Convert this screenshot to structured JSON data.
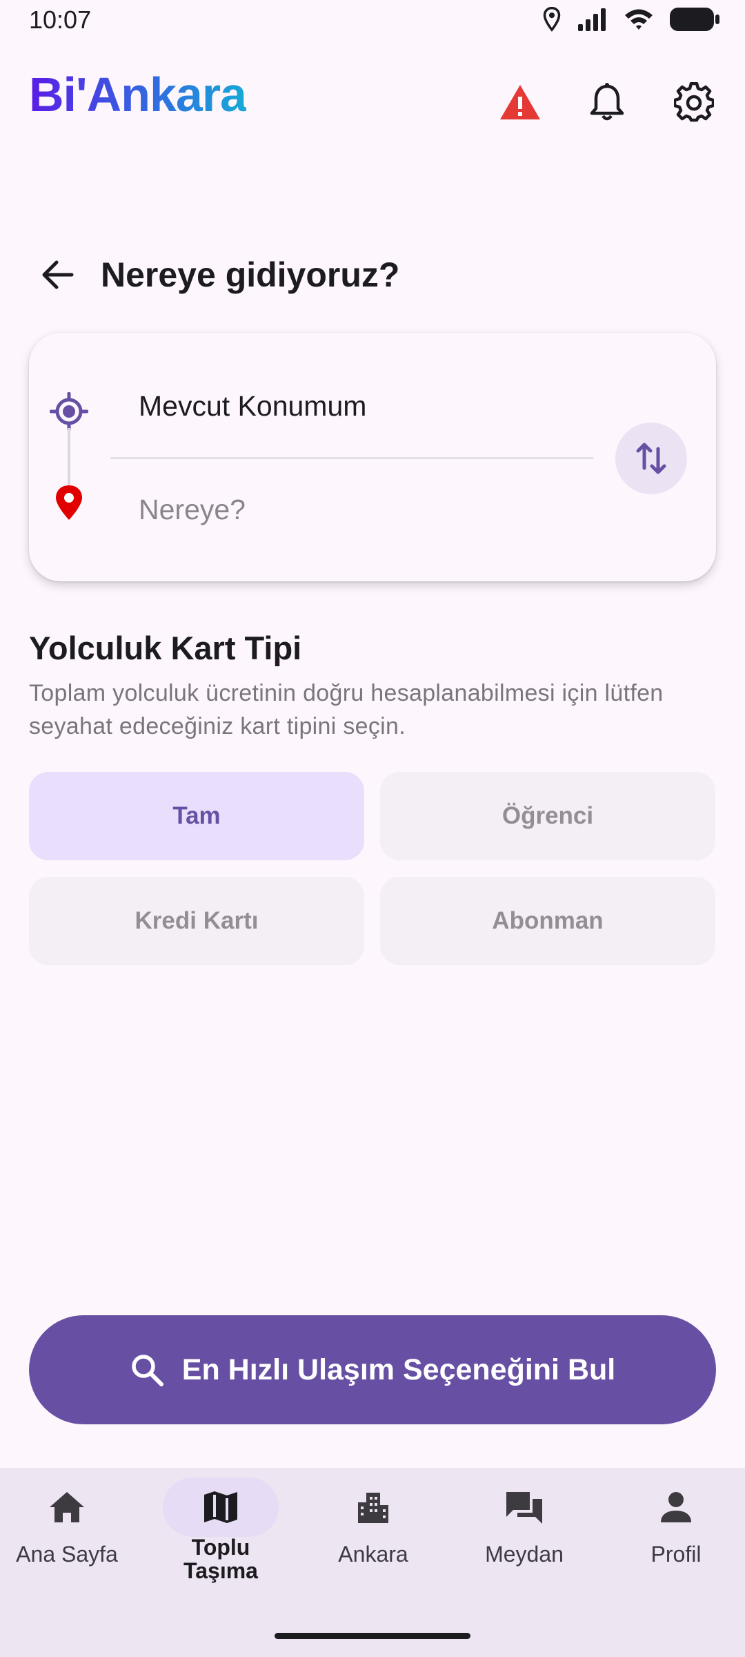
{
  "status_bar": {
    "time": "10:07"
  },
  "app": {
    "title": "Bi'Ankara"
  },
  "header_icons": [
    "warning-icon",
    "bell-icon",
    "settings-gear-icon"
  ],
  "page": {
    "title": "Nereye gidiyoruz?"
  },
  "route": {
    "origin": "Mevcut Konumum",
    "destination_placeholder": "Nereye?"
  },
  "card_type": {
    "title": "Yolculuk Kart Tipi",
    "description": "Toplam yolculuk ücretinin doğru hesaplanabilmesi için lütfen seyahat edeceğiniz kart tipini seçin.",
    "options": [
      "Tam",
      "Öğrenci",
      "Kredi Kartı",
      "Abonman"
    ],
    "selected": "Tam"
  },
  "primary_action": {
    "label": "En Hızlı Ulaşım Seçeneğini Bul"
  },
  "bottom_nav": {
    "items": [
      {
        "label": "Ana Sayfa",
        "icon": "home-icon"
      },
      {
        "label": "Toplu\nTaşıma",
        "icon": "map-icon"
      },
      {
        "label": "Ankara",
        "icon": "city-icon"
      },
      {
        "label": "Meydan",
        "icon": "forum-icon"
      },
      {
        "label": "Profil",
        "icon": "person-icon"
      }
    ],
    "active": "Toplu\nTaşıma"
  },
  "colors": {
    "primary": "#6750A4",
    "selected_chip_bg": "#E9DEFB",
    "warning": "#E53935",
    "destination_pin": "#E00000",
    "background": "#FDF7FD"
  }
}
